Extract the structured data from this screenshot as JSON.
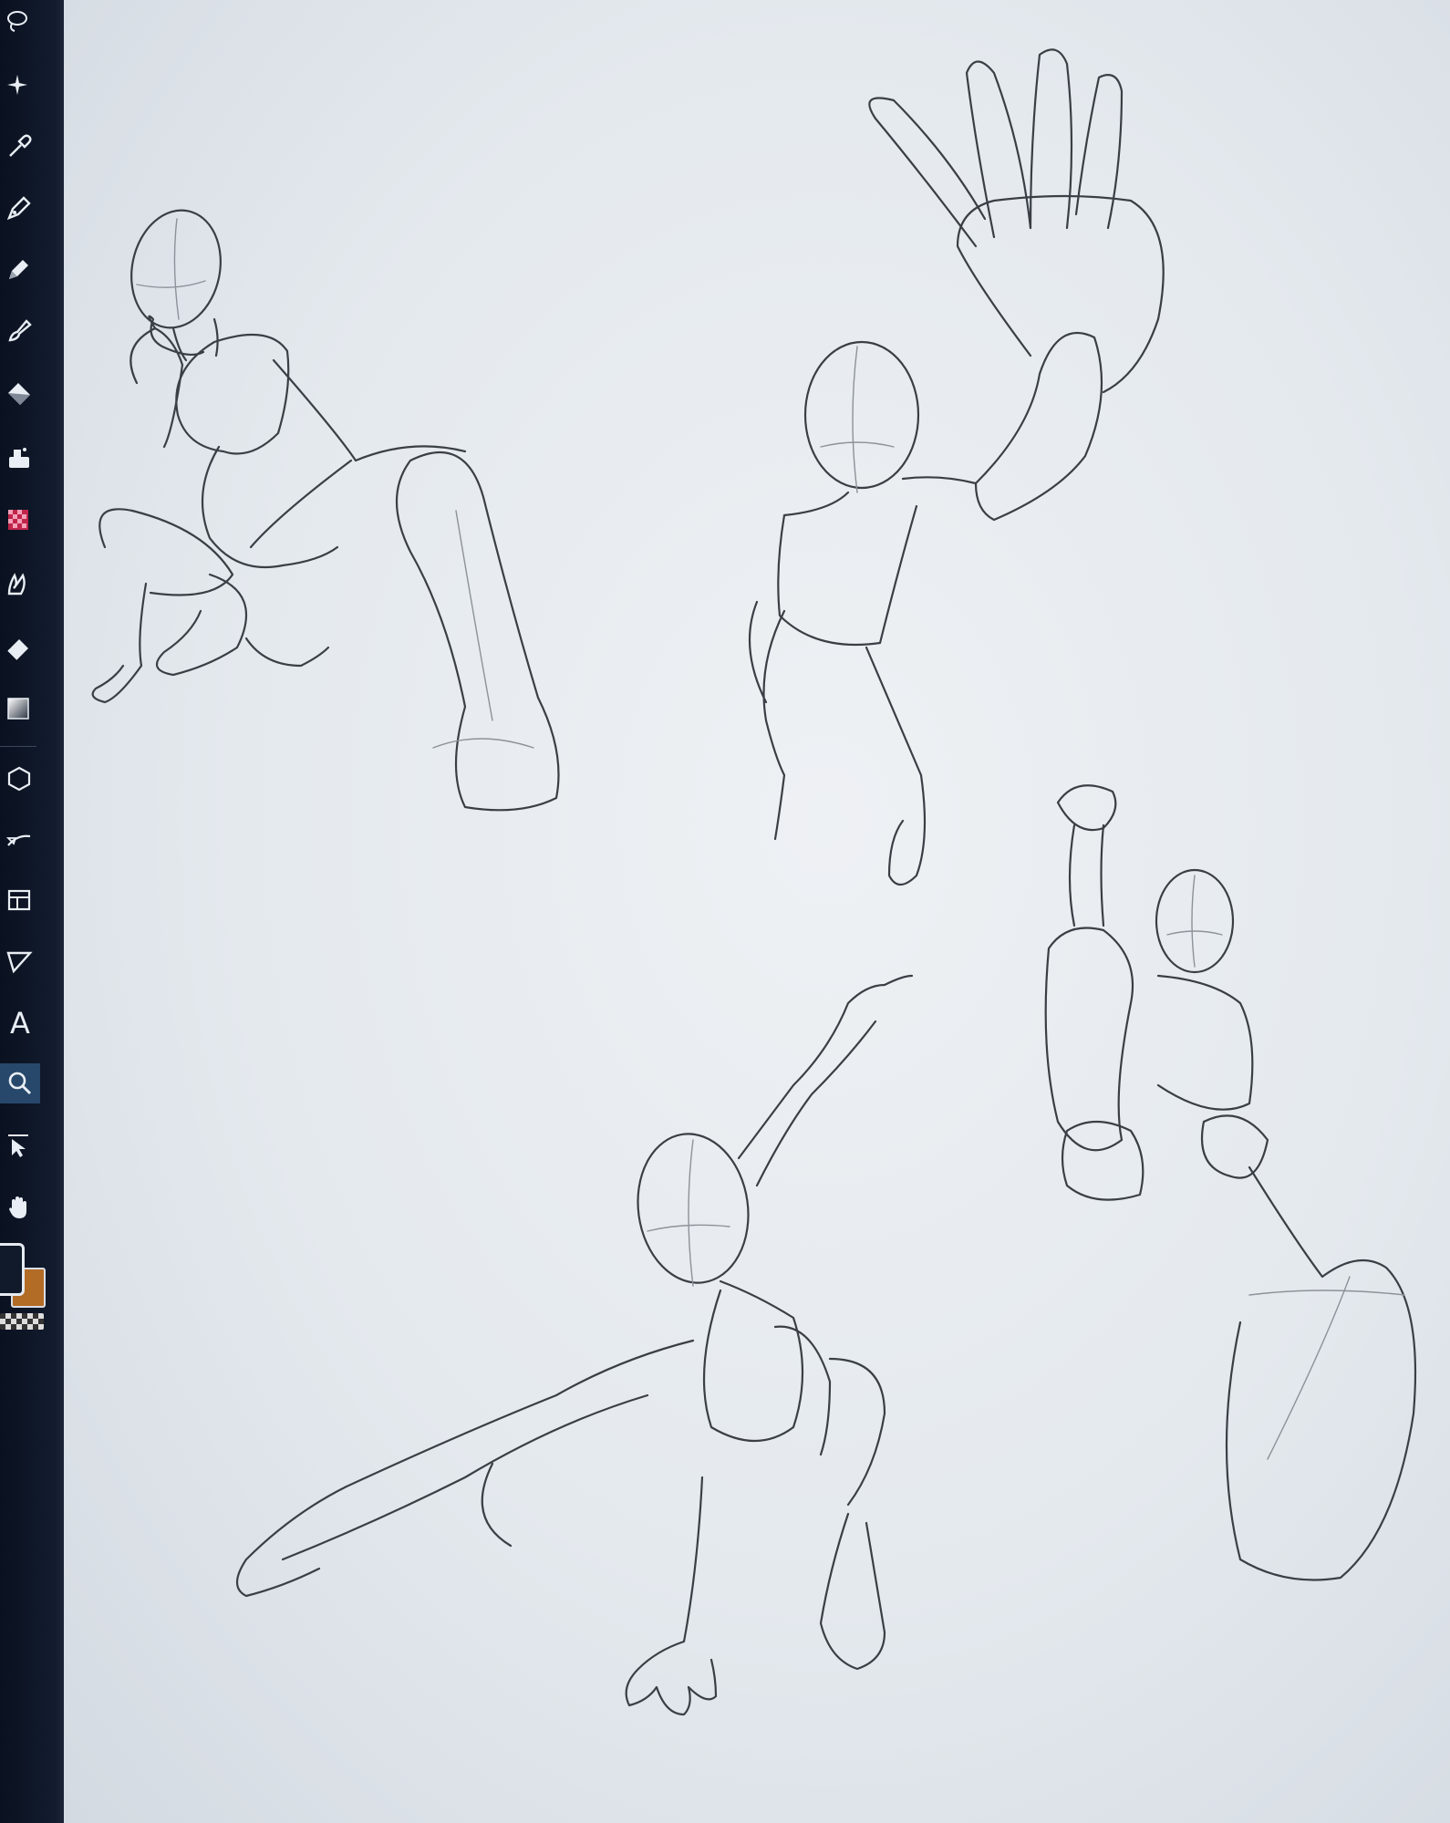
{
  "app": {
    "accent_color": "#27486b",
    "canvas_color": "#e8ecf0"
  },
  "toolbar": {
    "tools": [
      {
        "name": "lasso-icon"
      },
      {
        "name": "magic-wand-icon"
      },
      {
        "name": "eyedropper-icon"
      },
      {
        "name": "pen-icon"
      },
      {
        "name": "pencil-icon"
      },
      {
        "name": "brush-icon"
      },
      {
        "name": "paint-bucket-icon"
      },
      {
        "name": "airbrush-icon"
      },
      {
        "name": "decoration-icon"
      },
      {
        "name": "blend-icon"
      },
      {
        "name": "eraser-icon"
      },
      {
        "name": "gradient-icon"
      },
      {
        "name": "figure-icon"
      },
      {
        "name": "correct-line-icon"
      },
      {
        "name": "frame-icon"
      },
      {
        "name": "ruler-icon"
      },
      {
        "name": "text-tool",
        "label": "A"
      },
      {
        "name": "zoom-icon",
        "active": true
      },
      {
        "name": "select-layer-icon"
      },
      {
        "name": "hand-icon"
      }
    ],
    "colors": {
      "foreground": "#101a2a",
      "background": "#b26c26"
    }
  },
  "canvas": {
    "content": "gesture-sketches"
  }
}
